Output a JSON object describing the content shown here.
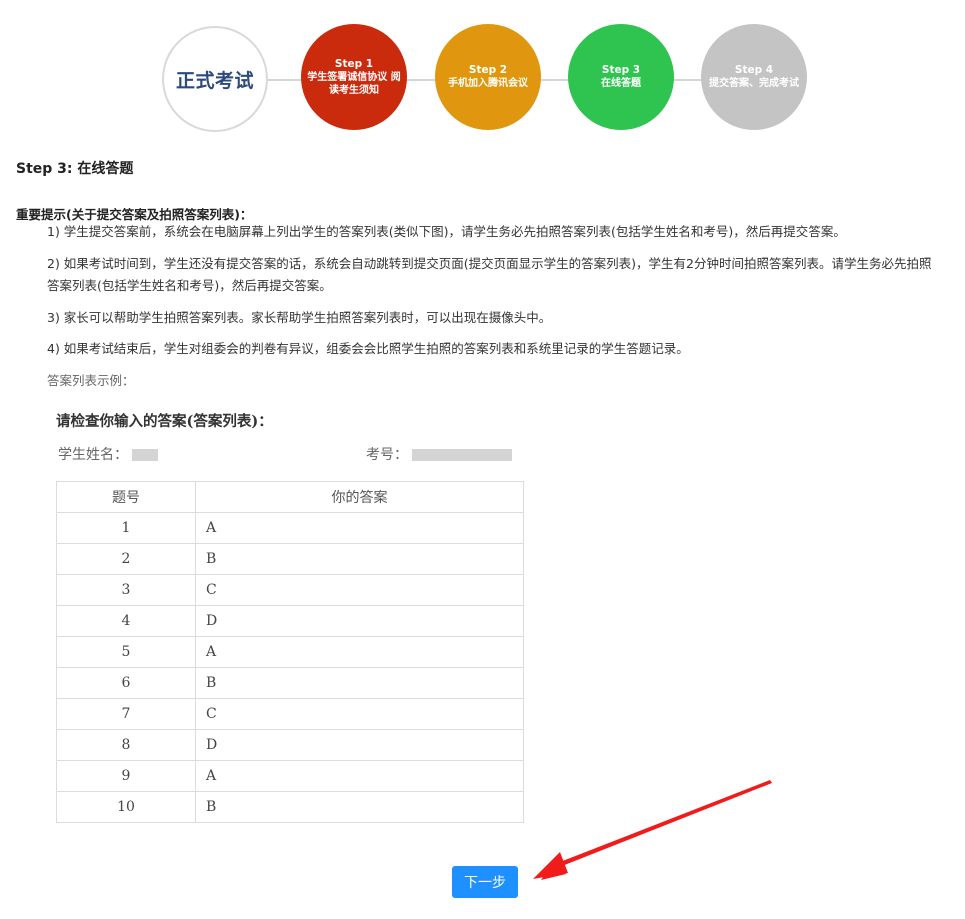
{
  "steps": {
    "title": "正式考试",
    "items": [
      {
        "step": "Step 1",
        "label": "学生签署诚信协议 阅读考生须知",
        "color": "#c92b0c"
      },
      {
        "step": "Step 2",
        "label": "手机加入腾讯会议",
        "color": "#e0960e"
      },
      {
        "step": "Step 3",
        "label": "在线答题",
        "color": "#2ec44f"
      },
      {
        "step": "Step 4",
        "label": "提交答案、完成考试",
        "color": "#c4c4c4"
      }
    ]
  },
  "heading": "Step 3: 在线答题",
  "notice": {
    "title": "重要提示(关于提交答案及拍照答案列表)：",
    "items": [
      "1) 学生提交答案前，系统会在电脑屏幕上列出学生的答案列表(类似下图)，请学生务必先拍照答案列表(包括学生姓名和考号)，然后再提交答案。",
      "2) 如果考试时间到，学生还没有提交答案的话，系统会自动跳转到提交页面(提交页面显示学生的答案列表)，学生有2分钟时间拍照答案列表。请学生务必先拍照答案列表(包括学生姓名和考号)，然后再提交答案。",
      "3) 家长可以帮助学生拍照答案列表。家长帮助学生拍照答案列表时，可以出现在摄像头中。",
      "4) 如果考试结束后，学生对组委会的判卷有异议，组委会会比照学生拍照的答案列表和系统里记录的学生答题记录。"
    ],
    "example_label": "答案列表示例："
  },
  "sample": {
    "title": "请检查你输入的答案(答案列表)：",
    "name_label": "学生姓名：",
    "id_label": "考号：",
    "columns": [
      "题号",
      "你的答案"
    ],
    "rows": [
      [
        "1",
        "A"
      ],
      [
        "2",
        "B"
      ],
      [
        "3",
        "C"
      ],
      [
        "4",
        "D"
      ],
      [
        "5",
        "A"
      ],
      [
        "6",
        "B"
      ],
      [
        "7",
        "C"
      ],
      [
        "8",
        "D"
      ],
      [
        "9",
        "A"
      ],
      [
        "10",
        "B"
      ]
    ]
  },
  "next_button": "下一步",
  "colors": {
    "button": "#1e90ff",
    "arrow": "#f01c1c"
  }
}
